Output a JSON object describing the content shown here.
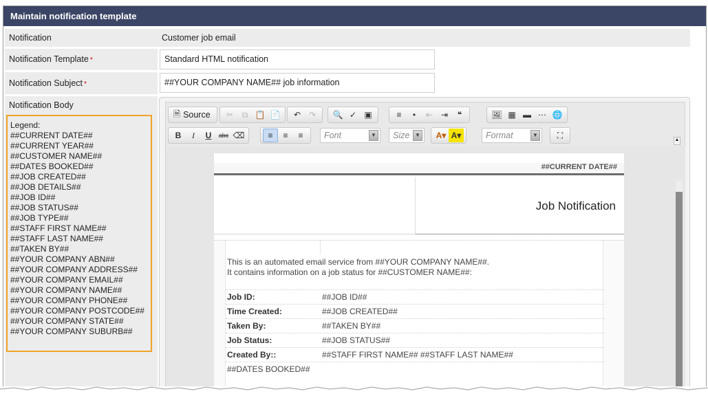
{
  "window": {
    "title": "Maintain notification template"
  },
  "form": {
    "notification_label": "Notification",
    "notification_value": "Customer job email",
    "template_label": "Notification Template",
    "template_value": "Standard HTML notification",
    "subject_label": "Notification Subject",
    "subject_value": "##YOUR COMPANY NAME## job information",
    "body_label": "Notification Body",
    "required_mark": "*"
  },
  "legend": {
    "title": "Legend:",
    "items": [
      "##CURRENT DATE##",
      "##CURRENT YEAR##",
      "##CUSTOMER NAME##",
      "##DATES BOOKED##",
      "##JOB CREATED##",
      "##JOB DETAILS##",
      "##JOB ID##",
      "##JOB STATUS##",
      "##JOB TYPE##",
      "##STAFF FIRST NAME##",
      "##STAFF LAST NAME##",
      "##TAKEN BY##",
      "##YOUR COMPANY ABN##",
      "##YOUR COMPANY ADDRESS##",
      "##YOUR COMPANY EMAIL##",
      "##YOUR COMPANY NAME##",
      "##YOUR COMPANY PHONE##",
      "##YOUR COMPANY POSTCODE##",
      "##YOUR COMPANY STATE##",
      "##YOUR COMPANY SUBURB##"
    ]
  },
  "toolbar": {
    "source_label": "Source",
    "font_placeholder": "Font",
    "size_placeholder": "Size",
    "format_placeholder": "Format",
    "bold": "B",
    "italic": "I",
    "underline": "U",
    "strike": "abc"
  },
  "document": {
    "current_date": "##CURRENT DATE##",
    "heading": "Job Notification",
    "intro_line1": "This is an automated email service from ##YOUR COMPANY NAME##.",
    "intro_line2": "It contains information on a job status for ##CUSTOMER NAME##:",
    "rows": [
      {
        "label": "Job ID:",
        "value": "##JOB ID##"
      },
      {
        "label": "Time Created:",
        "value": "##JOB CREATED##"
      },
      {
        "label": "Taken By:",
        "value": "##TAKEN BY##"
      },
      {
        "label": "Job Status:",
        "value": "##JOB STATUS##"
      },
      {
        "label": "Created By::",
        "value": "##STAFF FIRST NAME## ##STAFF LAST NAME##"
      }
    ],
    "dates_booked": "##DATES BOOKED##"
  },
  "colors": {
    "title_bar": "#3b4565",
    "legend_border": "#f0a328",
    "required": "#d00000"
  }
}
